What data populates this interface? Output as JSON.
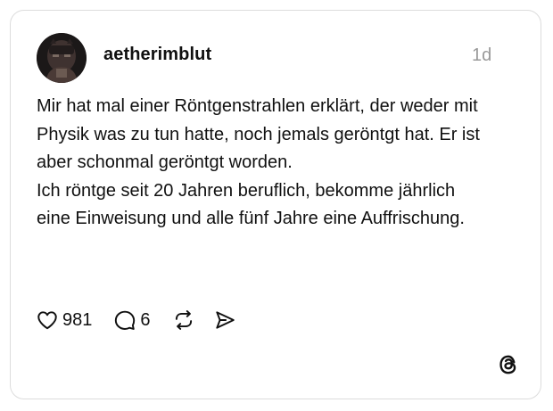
{
  "post": {
    "username": "aetherimblut",
    "timestamp": "1d",
    "paragraph1": "Mir hat mal einer Röntgenstrahlen erklärt, der weder mit Physik was zu tun hatte, noch jemals geröntgt hat. Er ist aber schonmal geröntgt worden.",
    "paragraph2": "Ich röntge seit 20 Jahren beruflich, bekomme jährlich eine Einweisung und alle fünf Jahre eine Auffrischung."
  },
  "actions": {
    "likes": "981",
    "replies": "6"
  },
  "icons": {
    "like": "heart-icon",
    "reply": "comment-icon",
    "repost": "repost-icon",
    "share": "send-icon",
    "brand": "threads-logo-icon"
  }
}
